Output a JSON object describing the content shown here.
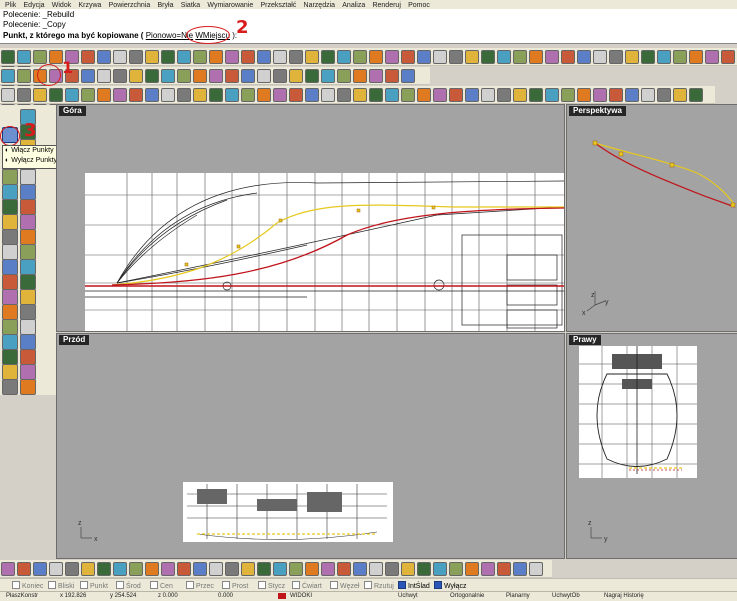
{
  "menu": [
    "Plik",
    "Edycja",
    "Widok",
    "Krzywa",
    "Powierzchnia",
    "Bryła",
    "Siatka",
    "Wymiarowanie",
    "Przekształć",
    "Narzędzia",
    "Analiza",
    "Renderuj",
    "Pomoc"
  ],
  "command": {
    "history1": "Polecenie: _Rebuild",
    "history2": "Polecenie: _Copy",
    "prompt_main": "Punkt, z którego ma być kopiowane (",
    "opt_vertical": "Pionowo=Nie",
    "opt_inplace": "WMiejscu",
    "prompt_end": "):"
  },
  "annotations": {
    "n1": "1",
    "n2": "2",
    "n3": "3"
  },
  "tooltip": {
    "line1": "Włącz Punkty Edycyjne",
    "line2": "Wyłącz Punkty"
  },
  "viewports": {
    "top": "Góra",
    "perspective": "Perspektywa",
    "front": "Przód",
    "right": "Prawy"
  },
  "axes": {
    "x": "x",
    "y": "y",
    "z": "z"
  },
  "osnap": {
    "end": "Koniec",
    "near": "Bliski",
    "point": "Punkt",
    "mid": "Środ",
    "cen": "Cen",
    "perp": "Przec",
    "prost": "Prost",
    "tan": "Stycz",
    "quad": "Ćwiart",
    "knot": "Węzeł",
    "proj": "Rzutuj",
    "intslad": "IntŚlad",
    "disable": "Wyłącz"
  },
  "status": {
    "plane": "PłaszKonstr",
    "x": "x 192.826",
    "y": "y 254.524",
    "z": "z 0.000",
    "dist": "0.000",
    "layer": "WIDOKI",
    "grid": "Uchwyt",
    "ortho": "Ortogonalnie",
    "planar": "Planarny",
    "osnap": "UchwytOb",
    "history": "Nagraj Historię"
  },
  "colors": {
    "viewport_bg": "#a3a3a3",
    "curve_red": "#c0141b",
    "curve_yellow": "#e6c81e",
    "annotation": "#d81b1b",
    "tooltip_bg": "#ffffe1"
  }
}
